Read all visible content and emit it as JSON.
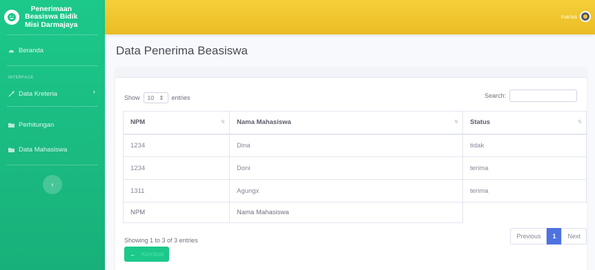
{
  "brand": {
    "title_line1": "Penerimaan",
    "title_line2": "Beasiswa Bidik",
    "title_line3": "Misi Darmajaya",
    "logo_icon": "laugh-wink-icon"
  },
  "sidebar": {
    "items": [
      {
        "label": "Beranda",
        "icon": "tachometer-icon"
      },
      {
        "label": "Data Kreteria",
        "icon": "wrench-icon"
      },
      {
        "label": "Perhitungan",
        "icon": "folder-icon"
      },
      {
        "label": "Data Mahasiswa",
        "icon": "folder-icon"
      }
    ],
    "heading": "INTERFACE",
    "toggle_icon": "chevron-left-icon"
  },
  "topbar": {
    "user_name": "mariss",
    "avatar_icon": "user-avatar-icon"
  },
  "page": {
    "title": "Data Penerima Beasiswa"
  },
  "table": {
    "length_prefix": "Show",
    "length_value": "10",
    "length_suffix": "entries",
    "search_label": "Search:",
    "search_value": "",
    "columns": [
      "NPM",
      "Nama Mahasiswa",
      "Status"
    ],
    "rows": [
      [
        "1234",
        "Dina",
        "tidak"
      ],
      [
        "1234",
        "Doni",
        "terima"
      ],
      [
        "1311",
        "Agungx",
        "terima"
      ]
    ],
    "footer_columns": [
      "NPM",
      "Nama Mahasiswa"
    ],
    "info": "Showing 1 to 3 of 3 entries",
    "pagination": {
      "previous": "Previous",
      "current": "1",
      "next": "Next"
    }
  },
  "actions": {
    "back_label": "Kembali",
    "back_icon": "arrow-left-icon"
  },
  "colors": {
    "sidebar": "#1cc88a",
    "topbar": "#f6c23e",
    "primary": "#4e73df"
  }
}
